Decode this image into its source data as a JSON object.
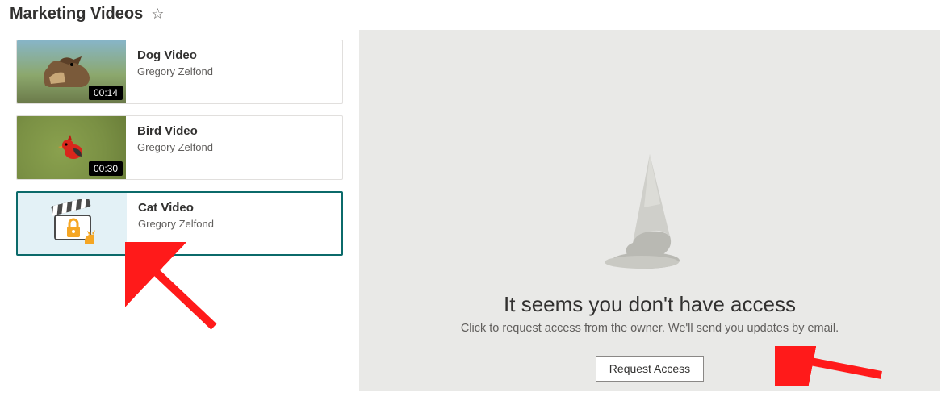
{
  "header": {
    "title": "Marketing Videos"
  },
  "videos": [
    {
      "title": "Dog Video",
      "author": "Gregory Zelfond",
      "duration": "00:14",
      "locked": false
    },
    {
      "title": "Bird Video",
      "author": "Gregory Zelfond",
      "duration": "00:30",
      "locked": false
    },
    {
      "title": "Cat Video",
      "author": "Gregory Zelfond",
      "duration": "",
      "locked": true
    }
  ],
  "access": {
    "title": "It seems you don't have access",
    "subtitle": "Click to request access from the owner. We'll send you updates by email.",
    "button_label": "Request Access"
  }
}
